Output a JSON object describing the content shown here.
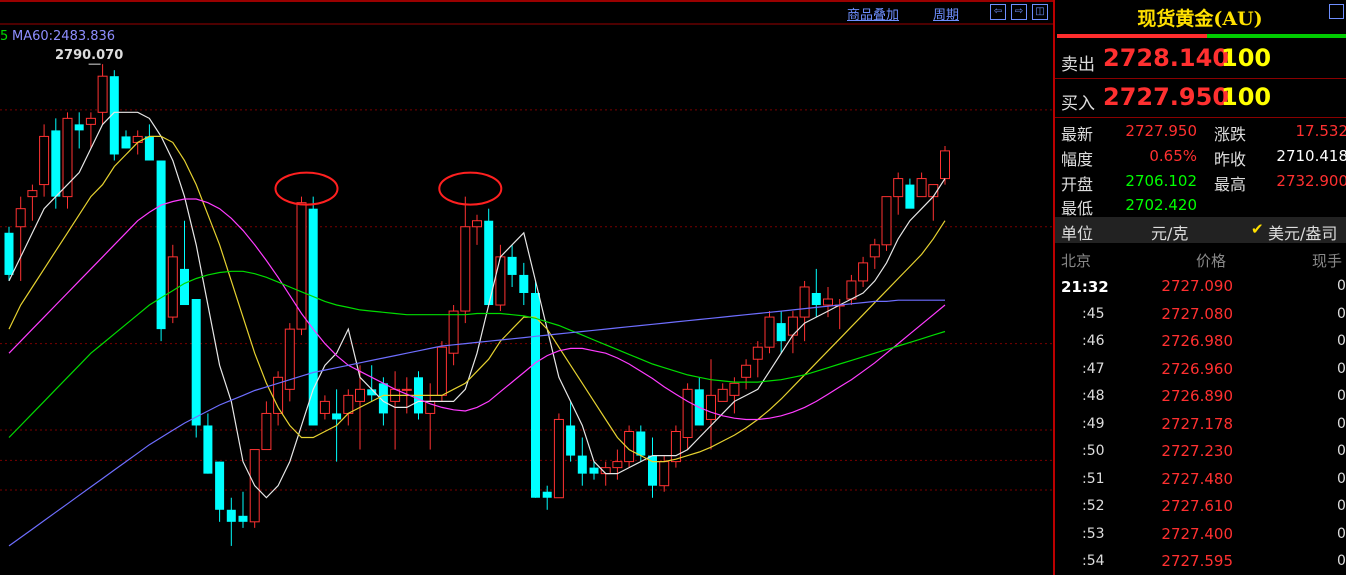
{
  "chart_links": {
    "overlay": "商品叠加",
    "period": "周期",
    "btn_left": "⇦",
    "btn_right": "⇨",
    "btn_split": "◫"
  },
  "ma_labels": {
    "ma_fragment": "5",
    "ma60": "MA60:2483.836"
  },
  "high_marker": "2790.070",
  "colors": {
    "up": "#ff3232",
    "down": "#00ffff",
    "ma5": "#e6e6e6",
    "ma10": "#e6d230",
    "ma20": "#ff3cff",
    "ma30": "#00dc00",
    "ma60": "#6e6eff",
    "grid": "#7a0000",
    "annotation": "#ff2020"
  },
  "chart_data": {
    "type": "candlestick",
    "title": "",
    "xlabel": "",
    "ylabel": "",
    "ylim": [
      2380,
      2835
    ],
    "grid": true,
    "candles": [
      [
        2660,
        2665,
        2620,
        2625
      ],
      [
        2665,
        2690,
        2620,
        2680
      ],
      [
        2690,
        2700,
        2670,
        2695
      ],
      [
        2700,
        2750,
        2690,
        2740
      ],
      [
        2745,
        2755,
        2680,
        2690
      ],
      [
        2690,
        2760,
        2680,
        2755
      ],
      [
        2750,
        2760,
        2730,
        2745
      ],
      [
        2750,
        2760,
        2730,
        2755
      ],
      [
        2760,
        2800,
        2750,
        2790
      ],
      [
        2790,
        2795,
        2720,
        2725
      ],
      [
        2740,
        2745,
        2730,
        2730
      ],
      [
        2735,
        2745,
        2725,
        2740
      ],
      [
        2740,
        2750,
        2720,
        2720
      ],
      [
        2720,
        2720,
        2570,
        2580
      ],
      [
        2590,
        2650,
        2585,
        2640
      ],
      [
        2630,
        2670,
        2600,
        2600
      ],
      [
        2605,
        2605,
        2490,
        2500
      ],
      [
        2500,
        2510,
        2460,
        2460
      ],
      [
        2470,
        2470,
        2420,
        2430
      ],
      [
        2430,
        2440,
        2400,
        2420
      ],
      [
        2425,
        2445,
        2415,
        2420
      ],
      [
        2420,
        2480,
        2415,
        2480
      ],
      [
        2480,
        2520,
        2480,
        2510
      ],
      [
        2510,
        2545,
        2500,
        2540
      ],
      [
        2530,
        2585,
        2520,
        2580
      ],
      [
        2580,
        2690,
        2575,
        2685
      ],
      [
        2680,
        2690,
        2500,
        2500
      ],
      [
        2510,
        2525,
        2505,
        2520
      ],
      [
        2510,
        2530,
        2470,
        2505
      ],
      [
        2510,
        2530,
        2500,
        2525
      ],
      [
        2520,
        2550,
        2480,
        2530
      ],
      [
        2530,
        2550,
        2520,
        2525
      ],
      [
        2535,
        2540,
        2500,
        2510
      ],
      [
        2520,
        2545,
        2480,
        2530
      ],
      [
        2530,
        2540,
        2510,
        2530
      ],
      [
        2540,
        2545,
        2505,
        2510
      ],
      [
        2510,
        2535,
        2480,
        2520
      ],
      [
        2525,
        2570,
        2520,
        2565
      ],
      [
        2560,
        2600,
        2550,
        2595
      ],
      [
        2595,
        2690,
        2585,
        2665
      ],
      [
        2665,
        2675,
        2650,
        2670
      ],
      [
        2670,
        2680,
        2600,
        2600
      ],
      [
        2600,
        2650,
        2595,
        2640
      ],
      [
        2640,
        2650,
        2615,
        2625
      ],
      [
        2625,
        2635,
        2600,
        2610
      ],
      [
        2610,
        2620,
        2440,
        2440
      ],
      [
        2445,
        2450,
        2430,
        2440
      ],
      [
        2440,
        2510,
        2440,
        2505
      ],
      [
        2500,
        2520,
        2470,
        2475
      ],
      [
        2475,
        2490,
        2450,
        2460
      ],
      [
        2465,
        2470,
        2455,
        2460
      ],
      [
        2460,
        2470,
        2450,
        2465
      ],
      [
        2465,
        2480,
        2455,
        2470
      ],
      [
        2470,
        2500,
        2465,
        2495
      ],
      [
        2495,
        2500,
        2470,
        2475
      ],
      [
        2475,
        2490,
        2440,
        2450
      ],
      [
        2450,
        2475,
        2445,
        2470
      ],
      [
        2470,
        2500,
        2465,
        2495
      ],
      [
        2490,
        2535,
        2480,
        2530
      ],
      [
        2530,
        2540,
        2500,
        2500
      ],
      [
        2505,
        2555,
        2480,
        2525
      ],
      [
        2520,
        2535,
        2520,
        2530
      ],
      [
        2525,
        2540,
        2510,
        2535
      ],
      [
        2540,
        2555,
        2530,
        2550
      ],
      [
        2555,
        2570,
        2540,
        2565
      ],
      [
        2565,
        2595,
        2560,
        2590
      ],
      [
        2585,
        2595,
        2560,
        2570
      ],
      [
        2575,
        2595,
        2560,
        2590
      ],
      [
        2590,
        2620,
        2570,
        2615
      ],
      [
        2610,
        2630,
        2590,
        2600
      ],
      [
        2600,
        2615,
        2590,
        2605
      ],
      [
        2600,
        2605,
        2580,
        2600
      ],
      [
        2605,
        2625,
        2600,
        2620
      ],
      [
        2620,
        2640,
        2615,
        2635
      ],
      [
        2640,
        2655,
        2630,
        2650
      ],
      [
        2650,
        2690,
        2645,
        2690
      ],
      [
        2690,
        2710,
        2675,
        2705
      ],
      [
        2700,
        2705,
        2685,
        2680
      ],
      [
        2690,
        2710,
        2690,
        2705
      ],
      [
        2690,
        2700,
        2670,
        2700
      ],
      [
        2705,
        2732,
        2700,
        2728
      ]
    ],
    "ma_series": {
      "MA5": [
        2620,
        2640,
        2660,
        2680,
        2690,
        2700,
        2710,
        2730,
        2750,
        2760,
        2760,
        2760,
        2755,
        2740,
        2720,
        2690,
        2650,
        2600,
        2550,
        2520,
        2470,
        2450,
        2440,
        2450,
        2470,
        2500,
        2530,
        2550,
        2560,
        2580,
        2540,
        2530,
        2520,
        2515,
        2515,
        2520,
        2520,
        2520,
        2520,
        2530,
        2560,
        2600,
        2640,
        2650,
        2660,
        2620,
        2580,
        2540,
        2520,
        2500,
        2470,
        2460,
        2460,
        2465,
        2470,
        2475,
        2475,
        2475,
        2480,
        2490,
        2500,
        2510,
        2520,
        2525,
        2530,
        2545,
        2560,
        2575,
        2585,
        2590,
        2595,
        2600,
        2605,
        2610,
        2620,
        2635,
        2655,
        2670,
        2680,
        2690,
        2705
      ],
      "MA10": [
        2580,
        2600,
        2615,
        2630,
        2645,
        2660,
        2675,
        2690,
        2700,
        2715,
        2725,
        2735,
        2740,
        2740,
        2735,
        2720,
        2700,
        2675,
        2650,
        2620,
        2590,
        2560,
        2535,
        2515,
        2500,
        2490,
        2490,
        2495,
        2500,
        2510,
        2515,
        2520,
        2525,
        2525,
        2525,
        2525,
        2525,
        2525,
        2530,
        2535,
        2545,
        2555,
        2570,
        2580,
        2590,
        2590,
        2580,
        2565,
        2550,
        2535,
        2520,
        2505,
        2490,
        2480,
        2475,
        2470,
        2470,
        2472,
        2475,
        2478,
        2482,
        2487,
        2492,
        2498,
        2505,
        2513,
        2522,
        2532,
        2542,
        2552,
        2562,
        2572,
        2582,
        2592,
        2602,
        2612,
        2622,
        2632,
        2642,
        2655,
        2670
      ],
      "MA20": [
        2560,
        2570,
        2580,
        2590,
        2600,
        2610,
        2620,
        2630,
        2640,
        2650,
        2660,
        2670,
        2677,
        2683,
        2686,
        2688,
        2688,
        2685,
        2680,
        2672,
        2662,
        2650,
        2637,
        2623,
        2608,
        2593,
        2580,
        2568,
        2558,
        2550,
        2545,
        2540,
        2535,
        2530,
        2526,
        2522,
        2518,
        2515,
        2513,
        2512,
        2515,
        2520,
        2528,
        2536,
        2544,
        2552,
        2558,
        2562,
        2564,
        2564,
        2562,
        2560,
        2556,
        2551,
        2545,
        2539,
        2532,
        2526,
        2520,
        2515,
        2511,
        2508,
        2506,
        2505,
        2505,
        2506,
        2508,
        2511,
        2515,
        2520,
        2526,
        2532,
        2538,
        2545,
        2552,
        2560,
        2568,
        2576,
        2584,
        2592,
        2600
      ],
      "MA30": [
        2490,
        2500,
        2510,
        2520,
        2530,
        2540,
        2550,
        2560,
        2568,
        2576,
        2584,
        2592,
        2600,
        2606,
        2612,
        2618,
        2622,
        2625,
        2627,
        2628,
        2628,
        2626,
        2623,
        2619,
        2615,
        2611,
        2607,
        2603,
        2600,
        2598,
        2596,
        2595,
        2594,
        2593,
        2592,
        2592,
        2592,
        2592,
        2592,
        2592,
        2593,
        2593,
        2593,
        2592,
        2591,
        2589,
        2586,
        2583,
        2579,
        2575,
        2571,
        2567,
        2563,
        2559,
        2555,
        2551,
        2548,
        2545,
        2542,
        2540,
        2538,
        2537,
        2536,
        2536,
        2536,
        2537,
        2538,
        2540,
        2542,
        2545,
        2548,
        2551,
        2554,
        2557,
        2560,
        2563,
        2566,
        2569,
        2572,
        2575,
        2578
      ],
      "MA60": [
        2400,
        2407,
        2414,
        2421,
        2428,
        2435,
        2442,
        2449,
        2456,
        2463,
        2470,
        2477,
        2484,
        2490,
        2496,
        2502,
        2507,
        2512,
        2517,
        2521,
        2525,
        2529,
        2532,
        2535,
        2538,
        2541,
        2544,
        2546,
        2548,
        2550,
        2552,
        2554,
        2556,
        2558,
        2560,
        2562,
        2564,
        2566,
        2567,
        2568,
        2569,
        2570,
        2571,
        2572,
        2573,
        2574,
        2575,
        2576,
        2577,
        2578,
        2579,
        2580,
        2581,
        2582,
        2583,
        2584,
        2585,
        2586,
        2587,
        2588,
        2589,
        2590,
        2591,
        2592,
        2593,
        2594,
        2595,
        2596,
        2597,
        2598,
        2599,
        2600,
        2601,
        2602,
        2603,
        2603,
        2604,
        2604,
        2604,
        2604,
        2604
      ]
    },
    "annotations": [
      "circle-top-1",
      "circle-top-2"
    ]
  },
  "quote": {
    "title": "现货黄金(AU)",
    "sell": {
      "label": "卖出",
      "price": "2728.140",
      "vol": "100"
    },
    "buy": {
      "label": "买入",
      "price": "2727.950",
      "vol": "100"
    },
    "stats": [
      {
        "label": "最新",
        "value": "2727.950",
        "color": "#ff3030"
      },
      {
        "label": "涨跌",
        "value": "17.532",
        "color": "#ff3030"
      },
      {
        "label": "幅度",
        "value": "0.65%",
        "color": "#ff3030"
      },
      {
        "label": "昨收",
        "value": "2710.418",
        "color": "#ffffff"
      },
      {
        "label": "开盘",
        "value": "2706.102",
        "color": "#00ff00"
      },
      {
        "label": "最高",
        "value": "2732.900",
        "color": "#ff3030"
      },
      {
        "label": "最低",
        "value": "2702.420",
        "color": "#00ff00"
      }
    ],
    "unit": {
      "label": "单位",
      "value": "元/克",
      "check": "✔",
      "option": "美元/盎司"
    },
    "ticks_header": {
      "time": "北京",
      "price": "价格",
      "vol": "现手"
    },
    "ticks": [
      {
        "time": "21:32",
        "price": "2727.090",
        "vol": "0"
      },
      {
        "time": ":45",
        "price": "2727.080",
        "vol": "0"
      },
      {
        "time": ":46",
        "price": "2726.980",
        "vol": "0"
      },
      {
        "time": ":47",
        "price": "2726.960",
        "vol": "0"
      },
      {
        "time": ":48",
        "price": "2726.890",
        "vol": "0"
      },
      {
        "time": ":49",
        "price": "2727.178",
        "vol": "0"
      },
      {
        "time": ":50",
        "price": "2727.230",
        "vol": "0"
      },
      {
        "time": ":51",
        "price": "2727.480",
        "vol": "0"
      },
      {
        "time": ":52",
        "price": "2727.610",
        "vol": "0"
      },
      {
        "time": ":53",
        "price": "2727.400",
        "vol": "0"
      },
      {
        "time": ":54",
        "price": "2727.595",
        "vol": "0"
      }
    ]
  }
}
